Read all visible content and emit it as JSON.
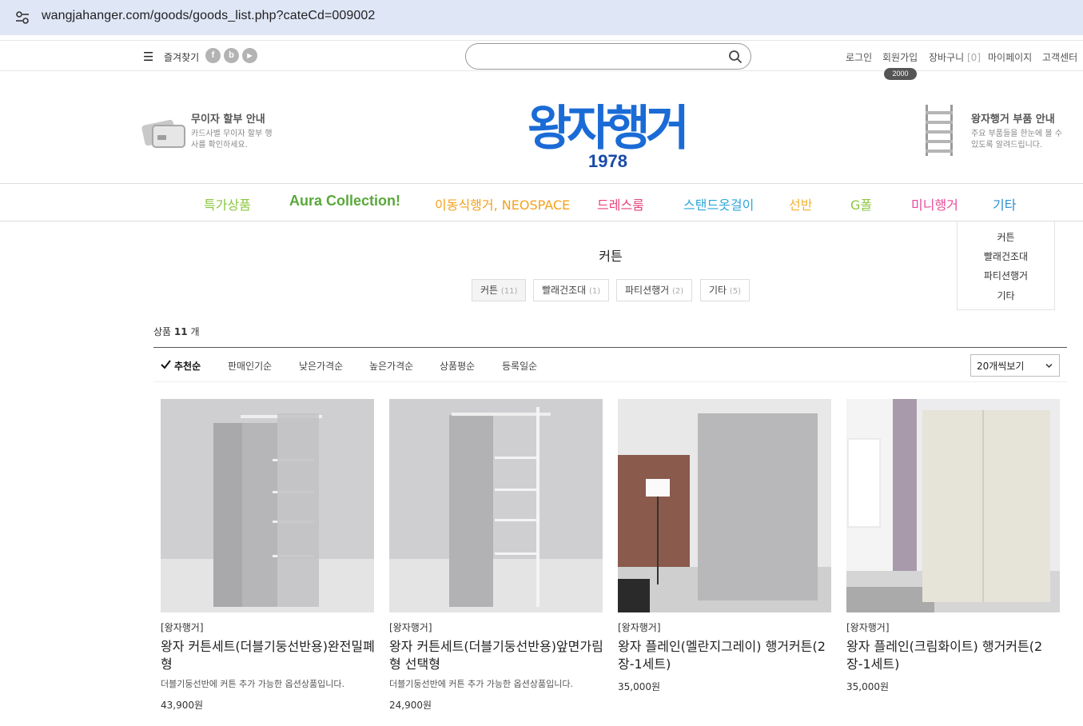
{
  "browser": {
    "url": "wangjahanger.com/goods/goods_list.php?cateCd=009002"
  },
  "topbar": {
    "favorites": "즐겨찾기",
    "sns": [
      "f",
      "b",
      "▶"
    ],
    "links": {
      "login": "로그인",
      "join": "회원가입",
      "cart": "장바구니",
      "cart_count": "[0]",
      "mypage": "마이페이지",
      "support": "고객센터"
    },
    "join_badge": "2000",
    "search_placeholder": ""
  },
  "header": {
    "promo_left": {
      "title": "무이자 할부 안내",
      "desc": "카드사별 무이자 할부 행사를 확인하세요."
    },
    "logo_text": "왕자행거",
    "logo_year": "1978",
    "promo_right": {
      "title": "왕자행거 부품 안내",
      "desc": "주요 부품들을 한눈에 볼 수 있도록 알려드립니다."
    }
  },
  "nav": {
    "categories": [
      {
        "label": "특가상품",
        "color": "#8cc63f"
      },
      {
        "label": "Aura Collection!",
        "color": "#5aa83a"
      },
      {
        "label": "이동식행거, NEOSPACE",
        "color": "#f3a21b"
      },
      {
        "label": "드레스룸",
        "color": "#e8427a"
      },
      {
        "label": "스탠드옷걸이",
        "color": "#2aa7d9"
      },
      {
        "label": "선반",
        "color": "#f2b233"
      },
      {
        "label": "G폴",
        "color": "#8cc63f"
      },
      {
        "label": "미니행거",
        "color": "#e84a9a"
      },
      {
        "label": "기타",
        "color": "#2a8fd0"
      }
    ],
    "dropdown": [
      "커튼",
      "빨래건조대",
      "파티션행거",
      "기타"
    ]
  },
  "listing": {
    "title": "커튼",
    "subcategories": [
      {
        "label": "커튼",
        "count": "(11)"
      },
      {
        "label": "빨래건조대",
        "count": "(1)"
      },
      {
        "label": "파티션행거",
        "count": "(2)"
      },
      {
        "label": "기타",
        "count": "(5)"
      }
    ],
    "count_label": "상품",
    "count_value": "11",
    "count_unit": "개",
    "sort_options": [
      "추천순",
      "판매인기순",
      "낮은가격순",
      "높은가격순",
      "상품평순",
      "등록일순"
    ],
    "per_page": "20개씩보기"
  },
  "products": [
    {
      "brand": "[왕자행거]",
      "name": "왕자 커튼세트(더블기둥선반용)완전밀폐형",
      "desc": "더블기둥선반에 커튼 추가 가능한 옵션상품입니다.",
      "price": "43,900원"
    },
    {
      "brand": "[왕자행거]",
      "name": "왕자 커튼세트(더블기둥선반용)앞면가림형 선택형",
      "desc": "더블기둥선반에 커튼 추가 가능한 옵션상품입니다.",
      "price": "24,900원"
    },
    {
      "brand": "[왕자행거]",
      "name": "왕자 플레인(멜란지그레이) 행거커튼(2장-1세트)",
      "desc": "",
      "price": "35,000원"
    },
    {
      "brand": "[왕자행거]",
      "name": "왕자 플레인(크림화이트) 행거커튼(2장-1세트)",
      "desc": "",
      "price": "35,000원"
    }
  ],
  "colors": {
    "accent": "#1a6bd6",
    "border": "#dddddd"
  }
}
